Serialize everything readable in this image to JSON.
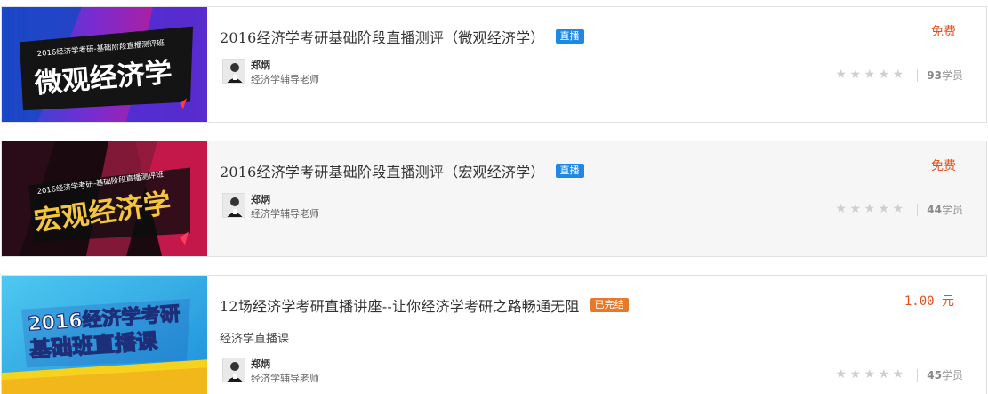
{
  "courses": [
    {
      "thumb_lines": [
        "2016经济学考研-基础阶段直播测评班",
        "微观经济学"
      ],
      "title": "2016经济学考研基础阶段直播测评（微观经济学）",
      "badge": "直播",
      "teacher_name": "郑炳",
      "teacher_role": "经济学辅导老师",
      "price": "免费",
      "rating": 0,
      "student_count": "93",
      "student_unit": "学员"
    },
    {
      "thumb_lines": [
        "2016经济学考研-基础阶段直播测评班",
        "宏观经济学"
      ],
      "title": "2016经济学考研基础阶段直播测评（宏观经济学）",
      "badge": "直播",
      "teacher_name": "郑炳",
      "teacher_role": "经济学辅导老师",
      "price": "免费",
      "rating": 0,
      "student_count": "44",
      "student_unit": "学员"
    },
    {
      "thumb_lines": [
        "2016经济学考研",
        "基础班直播课"
      ],
      "title": "12场经济学考研直播讲座--让你经济学考研之路畅通无阻",
      "badge": "已完结",
      "subtitle": "经济学直播课",
      "teacher_name": "郑炳",
      "teacher_role": "经济学辅导老师",
      "price": "1.00 元",
      "rating": 0,
      "student_count": "45",
      "student_unit": "学员"
    }
  ],
  "colors": {
    "live_badge": "#1e88e5",
    "ended_badge": "#e8782a",
    "price": "#e0501c",
    "star_empty": "#cfcfcf"
  },
  "icons": [
    "star-icon",
    "avatar"
  ]
}
